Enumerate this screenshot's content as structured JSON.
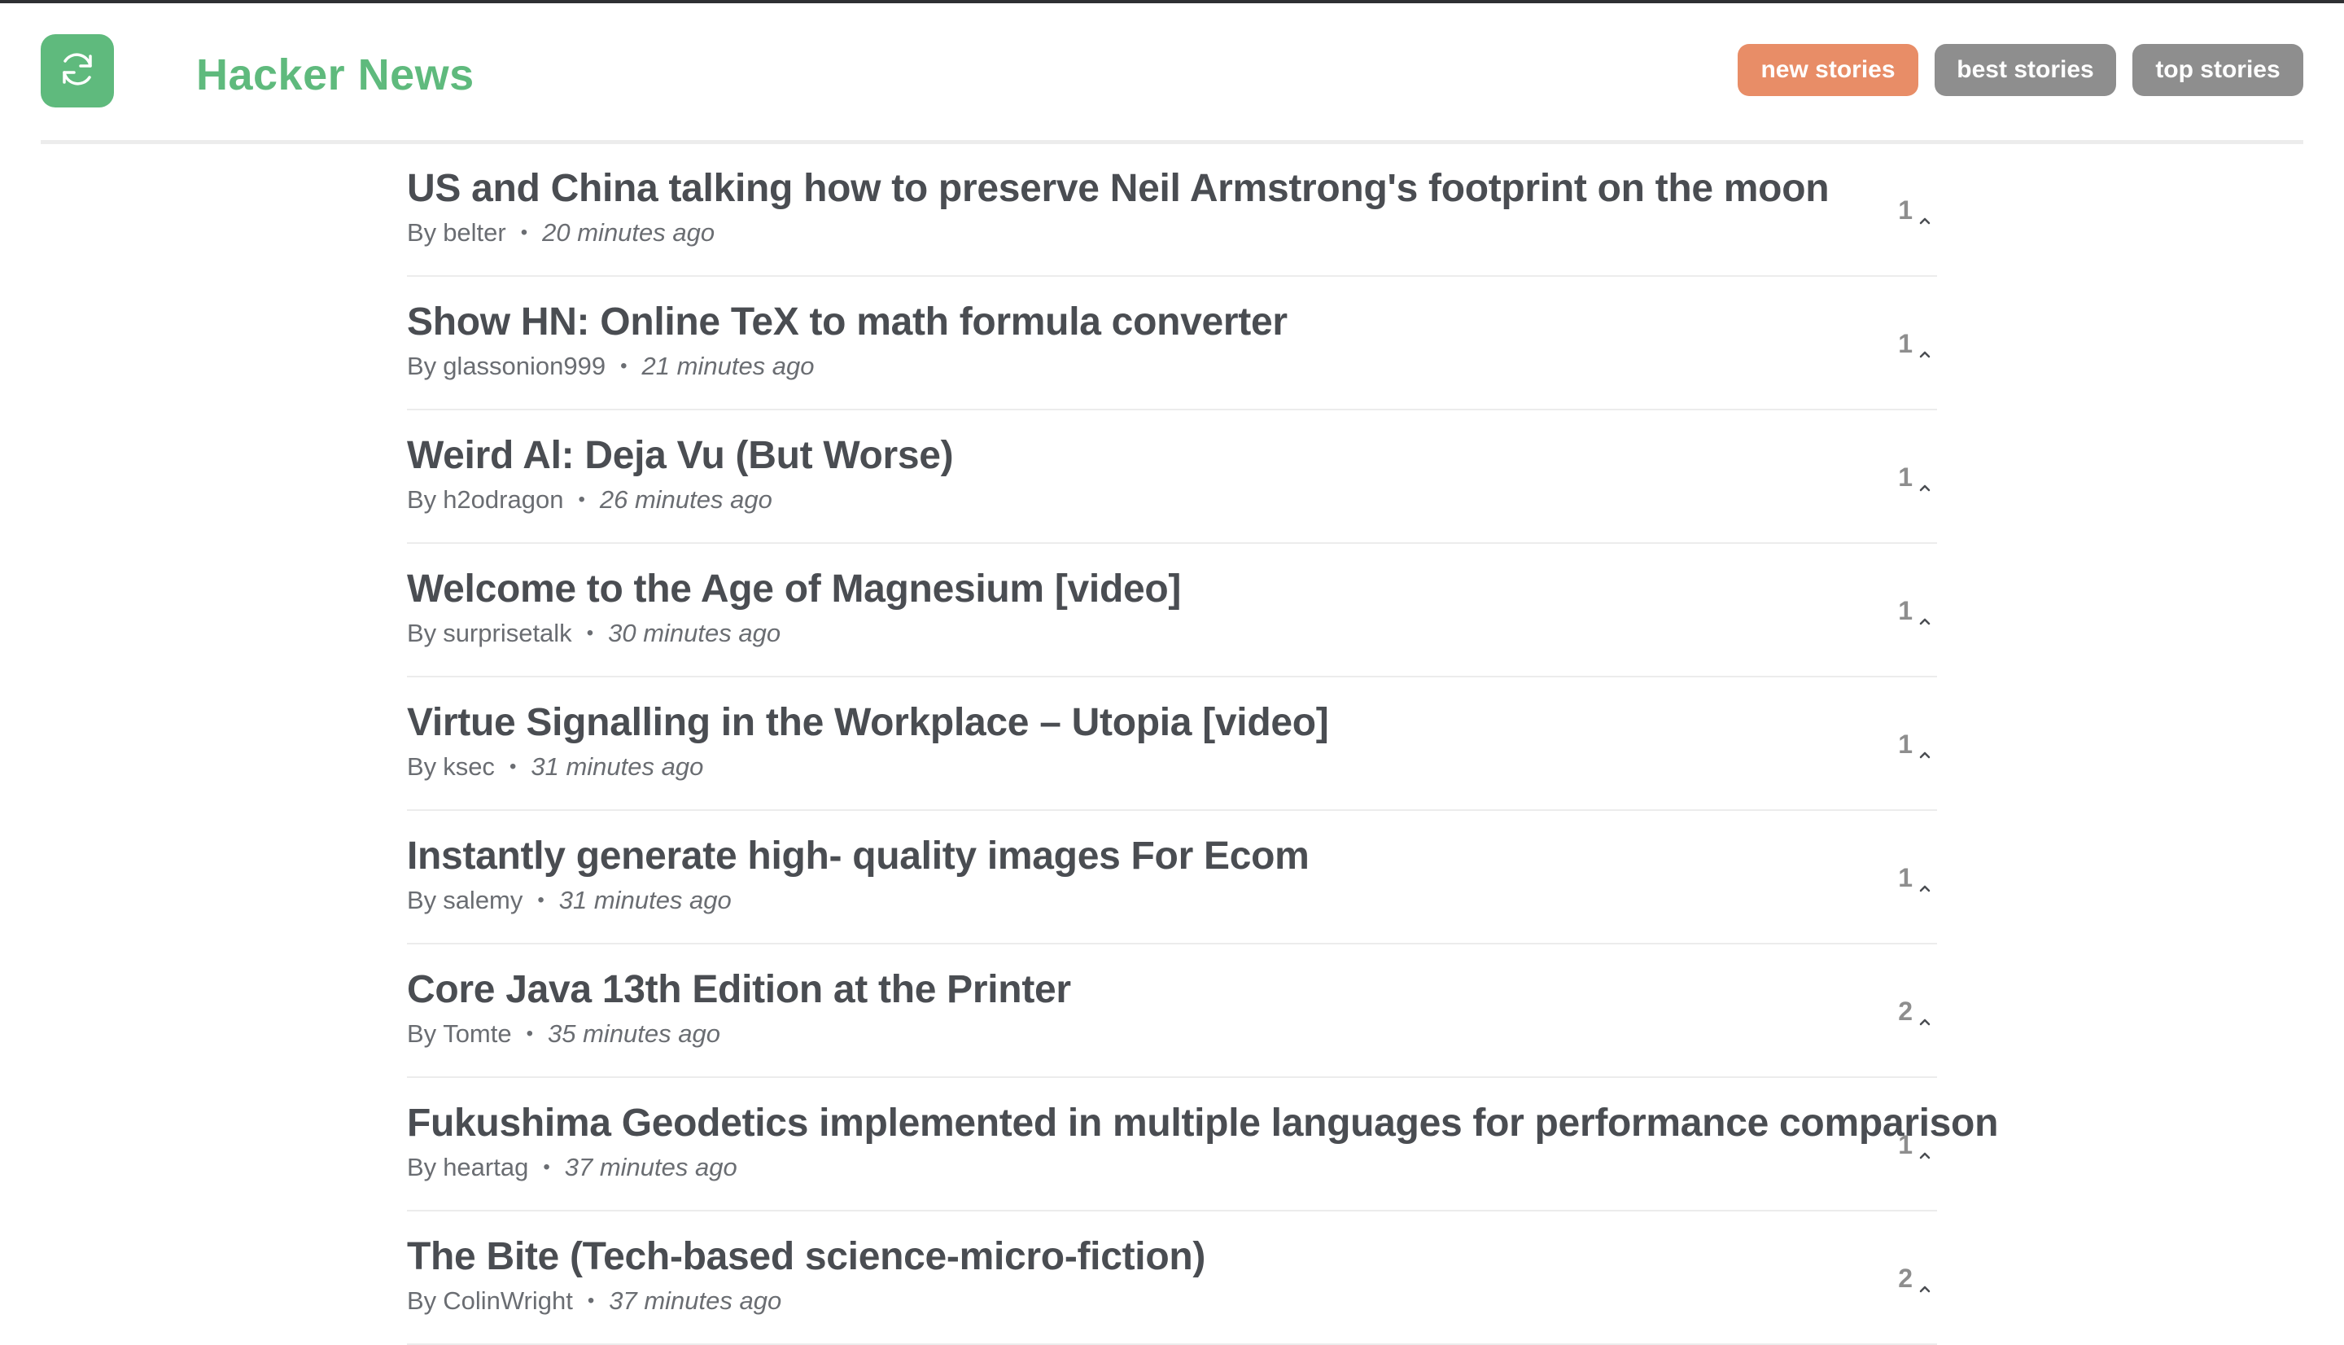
{
  "header": {
    "brand": "Hacker News",
    "logo_icon": "refresh-icon",
    "brand_color": "#5fba7d",
    "nav": [
      {
        "label": "new stories",
        "active": true
      },
      {
        "label": "best stories",
        "active": false
      },
      {
        "label": "top stories",
        "active": false
      }
    ],
    "active_color": "#e88d67",
    "inactive_color": "#8e8e8e"
  },
  "stories": [
    {
      "title": "US and China talking how to preserve Neil Armstrong's footprint on the moon",
      "by_label": "By",
      "author": "belter",
      "time": "20 minutes ago",
      "score": "1"
    },
    {
      "title": "Show HN: Online TeX to math formula converter",
      "by_label": "By",
      "author": "glassonion999",
      "time": "21 minutes ago",
      "score": "1"
    },
    {
      "title": "Weird Al: Deja Vu (But Worse)",
      "by_label": "By",
      "author": "h2odragon",
      "time": "26 minutes ago",
      "score": "1"
    },
    {
      "title": "Welcome to the Age of Magnesium [video]",
      "by_label": "By",
      "author": "surprisetalk",
      "time": "30 minutes ago",
      "score": "1"
    },
    {
      "title": "Virtue Signalling in the Workplace – Utopia [video]",
      "by_label": "By",
      "author": "ksec",
      "time": "31 minutes ago",
      "score": "1"
    },
    {
      "title": "Instantly generate high- quality images For Ecom",
      "by_label": "By",
      "author": "salemy",
      "time": "31 minutes ago",
      "score": "1"
    },
    {
      "title": "Core Java 13th Edition at the Printer",
      "by_label": "By",
      "author": "Tomte",
      "time": "35 minutes ago",
      "score": "2"
    },
    {
      "title": "Fukushima Geodetics implemented in multiple languages for performance comparison",
      "by_label": "By",
      "author": "heartag",
      "time": "37 minutes ago",
      "score": "1"
    },
    {
      "title": "The Bite (Tech-based science-micro-fiction)",
      "by_label": "By",
      "author": "ColinWright",
      "time": "37 minutes ago",
      "score": "2"
    }
  ]
}
